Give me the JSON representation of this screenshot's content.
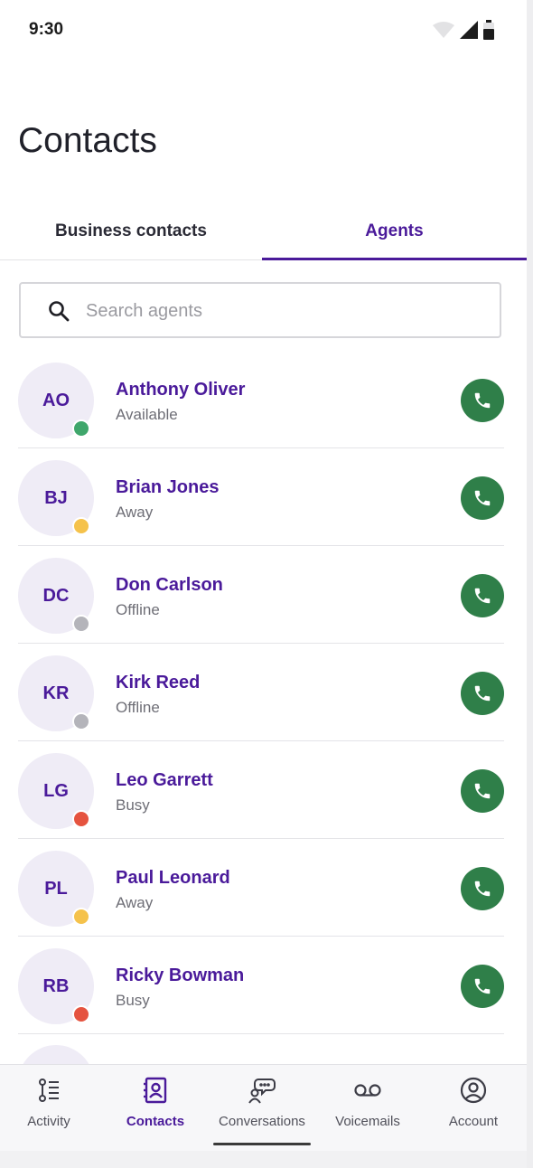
{
  "status_bar": {
    "time": "9:30"
  },
  "page": {
    "title": "Contacts"
  },
  "tabs": [
    {
      "label": "Business contacts",
      "active": false
    },
    {
      "label": "Agents",
      "active": true
    }
  ],
  "search": {
    "placeholder": "Search agents",
    "value": ""
  },
  "agents": [
    {
      "initials": "AO",
      "name": "Anthony Oliver",
      "status": "Available",
      "presence_color": "#3fa66b"
    },
    {
      "initials": "BJ",
      "name": "Brian Jones",
      "status": "Away",
      "presence_color": "#f5c24b"
    },
    {
      "initials": "DC",
      "name": "Don Carlson",
      "status": "Offline",
      "presence_color": "#b4b4ba"
    },
    {
      "initials": "KR",
      "name": "Kirk Reed",
      "status": "Offline",
      "presence_color": "#b4b4ba"
    },
    {
      "initials": "LG",
      "name": "Leo Garrett",
      "status": "Busy",
      "presence_color": "#e5533f"
    },
    {
      "initials": "PL",
      "name": "Paul Leonard",
      "status": "Away",
      "presence_color": "#f5c24b"
    },
    {
      "initials": "RB",
      "name": "Ricky Bowman",
      "status": "Busy",
      "presence_color": "#e5533f"
    }
  ],
  "bottom_nav": [
    {
      "label": "Activity",
      "icon": "activity-icon",
      "active": false
    },
    {
      "label": "Contacts",
      "icon": "contacts-icon",
      "active": true
    },
    {
      "label": "Conversations",
      "icon": "conversations-icon",
      "active": false
    },
    {
      "label": "Voicemails",
      "icon": "voicemail-icon",
      "active": false
    },
    {
      "label": "Account",
      "icon": "account-icon",
      "active": false
    }
  ],
  "colors": {
    "accent": "#4a1a9a",
    "call_button": "#2f7f49",
    "avatar_bg": "#efecf6"
  }
}
